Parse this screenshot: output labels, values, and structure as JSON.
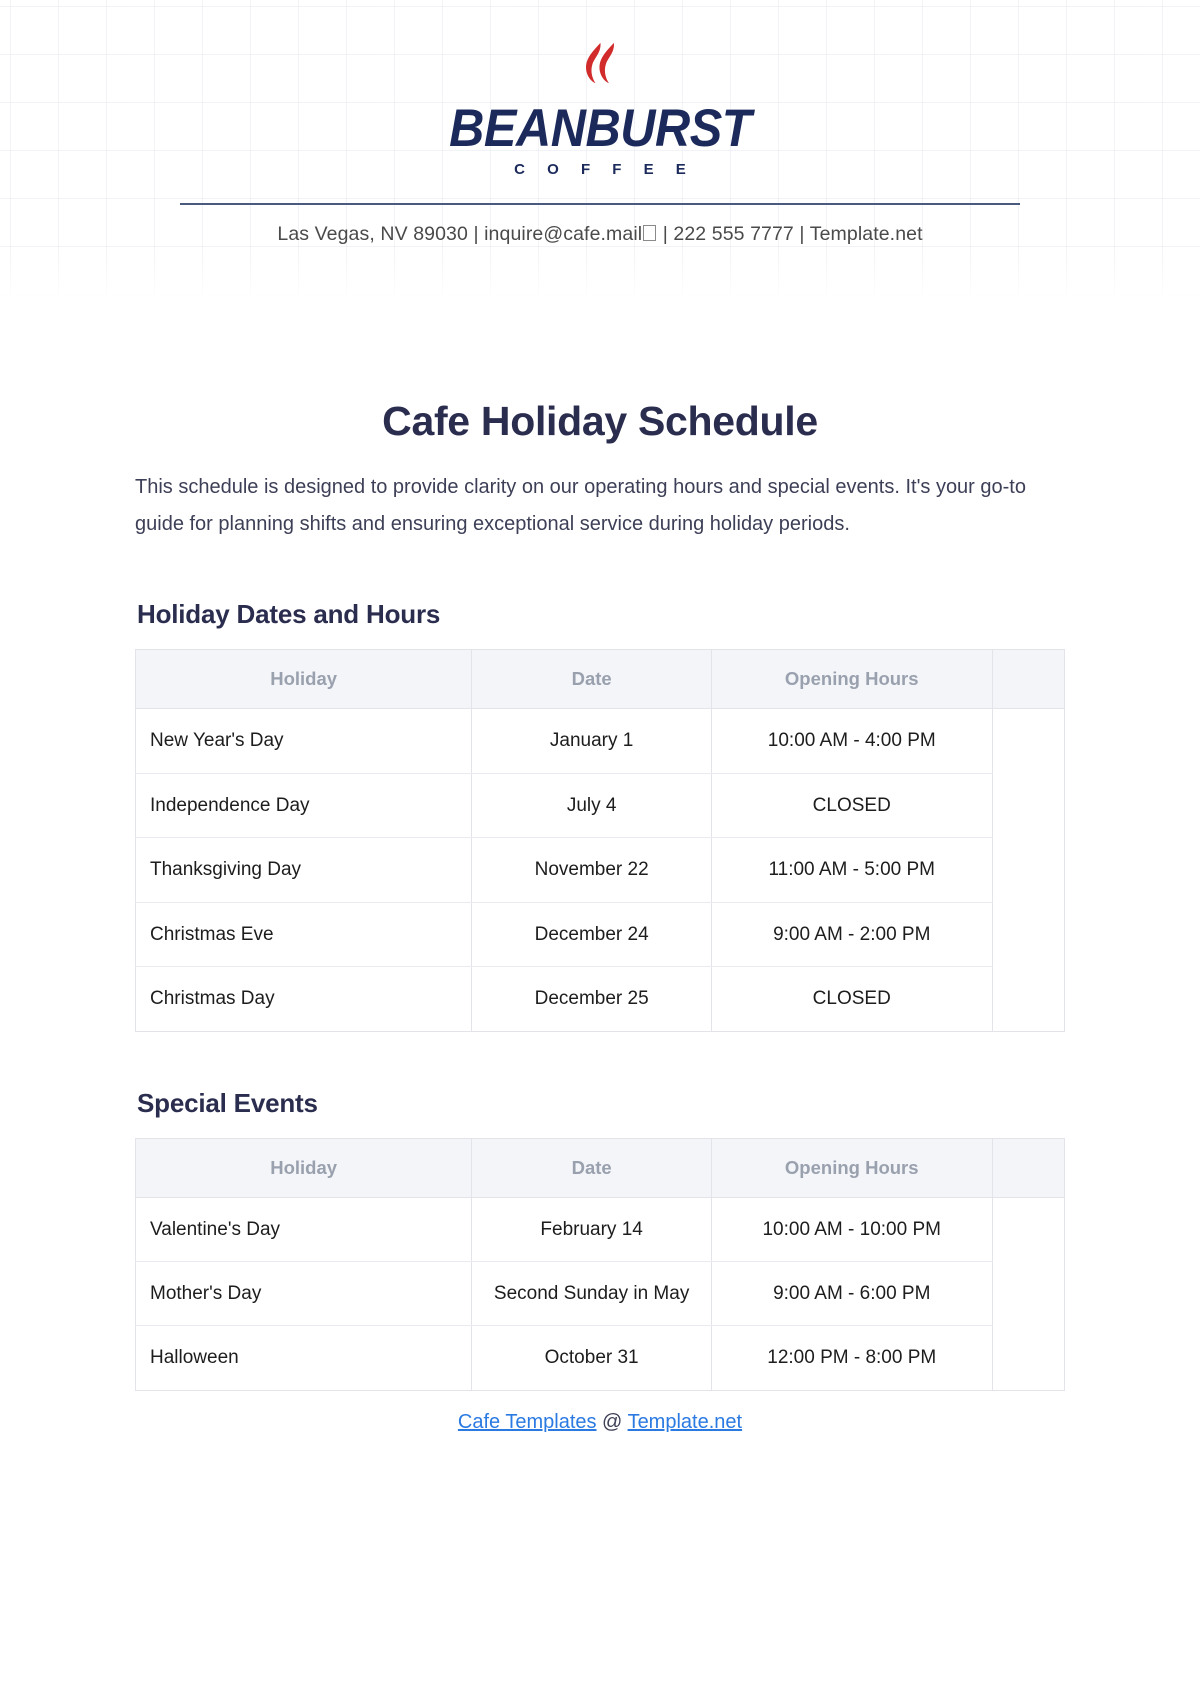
{
  "brand": {
    "logo_icon": "flame-icon",
    "name": "BEANBURST",
    "tagline": "C O F F E E",
    "flame_color": "#d12b2b",
    "name_color": "#1b2a5b"
  },
  "contact": {
    "address": "Las Vegas, NV 89030",
    "sep1": " | ",
    "email": "inquire@cafe.mail",
    "sep2": " | ",
    "phone": "222 555 7777",
    "sep3": " | ",
    "website": "Template.net",
    "full_line": "Las Vegas, NV 89030 | inquire@cafe.mail | 222 555 7777 | Template.net"
  },
  "document": {
    "title": "Cafe Holiday Schedule",
    "intro": "This schedule is designed to provide clarity on our operating hours and special events. It's your go-to guide for planning shifts and ensuring exceptional service during holiday periods."
  },
  "sections": [
    {
      "heading": "Holiday Dates and Hours",
      "columns": [
        "Holiday",
        "Date",
        "Opening Hours"
      ],
      "rows": [
        [
          "New Year's Day",
          "January 1",
          "10:00 AM - 4:00 PM"
        ],
        [
          "Independence Day",
          "July 4",
          "CLOSED"
        ],
        [
          "Thanksgiving Day",
          "November 22",
          "11:00 AM - 5:00 PM"
        ],
        [
          "Christmas Eve",
          "December 24",
          "9:00 AM - 2:00 PM"
        ],
        [
          "Christmas Day",
          "December 25",
          "CLOSED"
        ]
      ]
    },
    {
      "heading": "Special Events",
      "columns": [
        "Holiday",
        "Date",
        "Opening Hours"
      ],
      "rows": [
        [
          "Valentine's Day",
          "February 14",
          "10:00 AM - 10:00 PM"
        ],
        [
          "Mother's Day",
          "Second Sunday in May",
          "9:00 AM - 6:00 PM"
        ],
        [
          "Halloween",
          "October 31",
          "12:00 PM - 8:00 PM"
        ]
      ]
    }
  ],
  "footer": {
    "link1": "Cafe Templates",
    "middle": " @ ",
    "link2": "Template.net",
    "link_color": "#2a7ae2"
  }
}
